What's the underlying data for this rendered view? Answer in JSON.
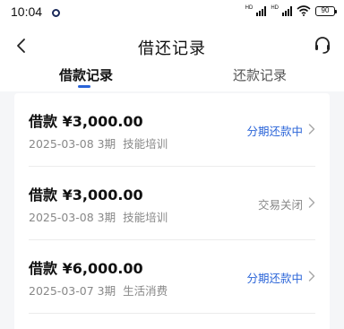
{
  "status_bar": {
    "time": "10:04",
    "signal1_label": "HD",
    "signal2_label": "HD",
    "battery": "90"
  },
  "nav": {
    "title": "借还记录"
  },
  "tabs": [
    {
      "label": "借款记录",
      "active": true
    },
    {
      "label": "还款记录",
      "active": false
    }
  ],
  "records": [
    {
      "prefix": "借款",
      "amount": "¥3,000.00",
      "date": "2025-03-08",
      "periods": "3期",
      "purpose": "技能培训",
      "status": "分期还款中",
      "status_tone": "blue"
    },
    {
      "prefix": "借款",
      "amount": "¥3,000.00",
      "date": "2025-03-08",
      "periods": "3期",
      "purpose": "技能培训",
      "status": "交易关闭",
      "status_tone": "gray"
    },
    {
      "prefix": "借款",
      "amount": "¥6,000.00",
      "date": "2025-03-07",
      "periods": "3期",
      "purpose": "生活消费",
      "status": "分期还款中",
      "status_tone": "blue"
    }
  ],
  "colors": {
    "accent": "#2a64d8",
    "muted": "#888888",
    "background": "#f5f6f8"
  }
}
